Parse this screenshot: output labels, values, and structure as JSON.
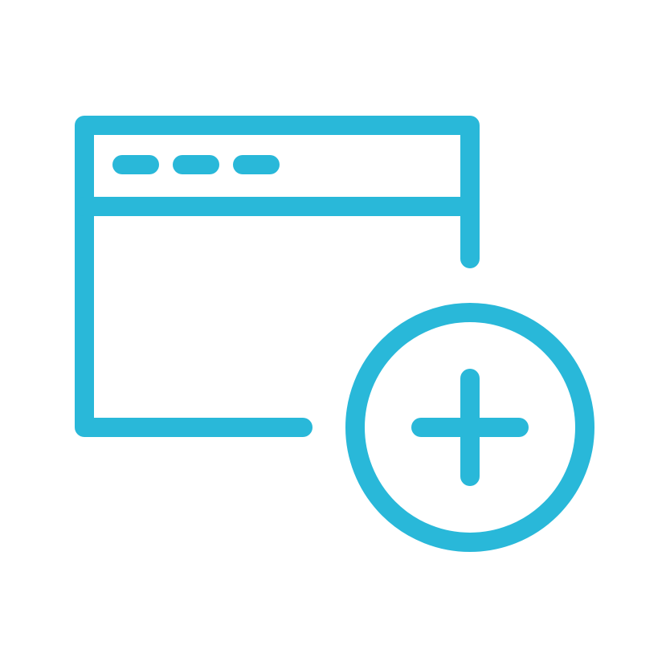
{
  "icon": {
    "name": "new-window-icon",
    "color": "#29b8d9",
    "background": "#ffffff",
    "parts": {
      "window": "browser-window-icon",
      "title_dots": [
        "window-dot-1",
        "window-dot-2",
        "window-dot-3"
      ],
      "badge": "add-circle-icon",
      "plus": "plus-icon"
    }
  }
}
